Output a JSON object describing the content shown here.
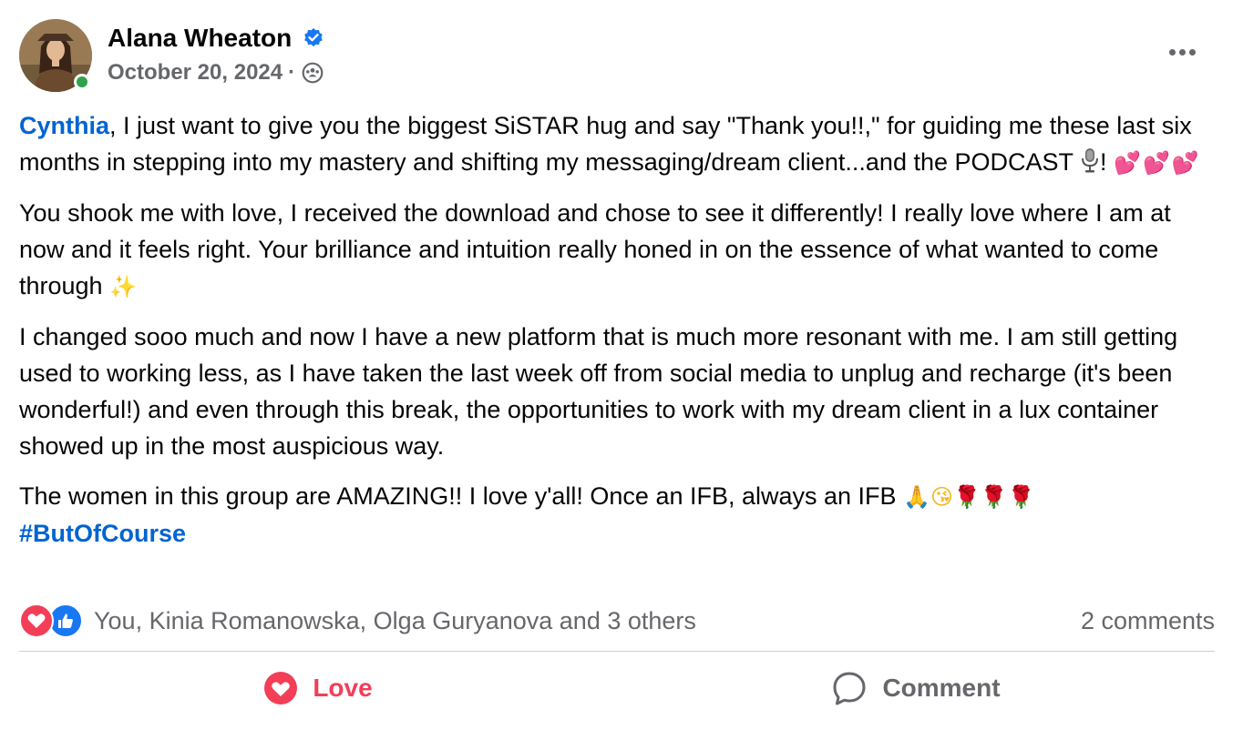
{
  "post": {
    "author": "Alana Wheaton",
    "date": "October 20, 2024",
    "separator": "·",
    "audience_icon": "group-audience-icon",
    "verified_icon": "verified-badge-icon",
    "more_icon": "more-options-icon"
  },
  "body": {
    "p1_mention": "Cynthia",
    "p1_text": ", I just want to give you the biggest SiSTAR hug and say \"Thank you!!,\" for guiding me these last six months in stepping into my mastery and shifting my messaging/dream client...and the PODCAST",
    "p1_after_mic": "!",
    "p1_emoji": "💕💕💕",
    "p2_text": "You shook me with love, I received the download and chose to see it differently! I really love where I am at now and it feels right. Your brilliance and intuition really honed in on the essence of what wanted to come through",
    "p2_emoji": "✨",
    "p3_text": "I changed sooo much and now I have a new platform that is much more resonant with me. I am still getting used to working less, as I have taken the last week off from social media to unplug and recharge (it's been wonderful!) and even through this break, the opportunities to work with my dream client in a lux container showed up in the most auspicious way.",
    "p4_text": "The women in this group are AMAZING!! I love y'all! Once an IFB, always an IFB",
    "p4_emoji_pray": "🙏",
    "p4_emoji_kiss": "😘",
    "p4_emoji_roses": "🌹🌹🌹",
    "hashtag": "#ButOfCourse"
  },
  "reactions": {
    "icons": [
      "love-reaction-icon",
      "like-reaction-icon"
    ],
    "reactors": "You, Kinia Romanowska, Olga Guryanova and 3 others",
    "comments_count": "2 comments"
  },
  "actions": {
    "love_label": "Love",
    "comment_label": "Comment"
  },
  "colors": {
    "link": "#0064d1",
    "love": "#f33e58",
    "like": "#1877f2",
    "secondary_text": "#65676b",
    "online": "#31a24c"
  }
}
